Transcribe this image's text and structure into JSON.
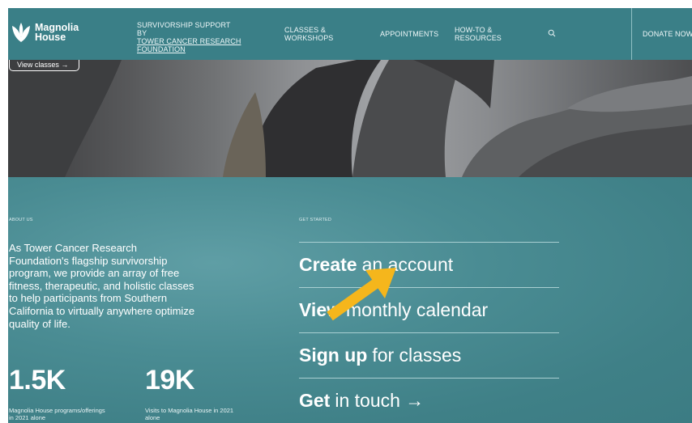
{
  "header": {
    "logo_line1": "Magnolia",
    "logo_line2": "House",
    "support_line1": "SURVIVORSHIP SUPPORT BY",
    "support_line2": "TOWER CANCER RESEARCH",
    "support_line3": "FOUNDATION",
    "nav_classes_1": "CLASSES &",
    "nav_classes_2": "WORKSHOPS",
    "nav_appointments": "APPOINTMENTS",
    "nav_howto_1": "HOW-TO &",
    "nav_howto_2": "RESOURCES",
    "nav_donate": "DONATE NOW"
  },
  "hero": {
    "view_classes": "View classes →"
  },
  "about": {
    "label": "ABOUT US",
    "text": "As Tower Cancer Research Foundation's flagship survivorship program, we provide an array of free fitness, therapeutic, and holistic classes to help participants from Southern California to virtually anywhere optimize quality of life.",
    "stats": [
      {
        "value": "1.5K",
        "caption": "Magnolia House programs/offerings in 2021 alone"
      },
      {
        "value": "19K",
        "caption": "Visits to Magnolia House in 2021 alone"
      }
    ]
  },
  "get_started": {
    "label": "GET STARTED",
    "actions": [
      {
        "bold": "Create",
        "rest": "an account"
      },
      {
        "bold": "View",
        "rest": "monthly calendar"
      },
      {
        "bold": "Sign up",
        "rest": "for classes"
      },
      {
        "bold": "Get",
        "rest": "in touch →"
      }
    ]
  },
  "colors": {
    "header_bg": "#3a7f87",
    "section_bg": "#4a8c93",
    "pointer_arrow": "#f5b61c"
  },
  "icons": [
    "magnolia-logo-icon",
    "search-icon",
    "arrow-right-icon",
    "pointer-arrow-icon"
  ]
}
